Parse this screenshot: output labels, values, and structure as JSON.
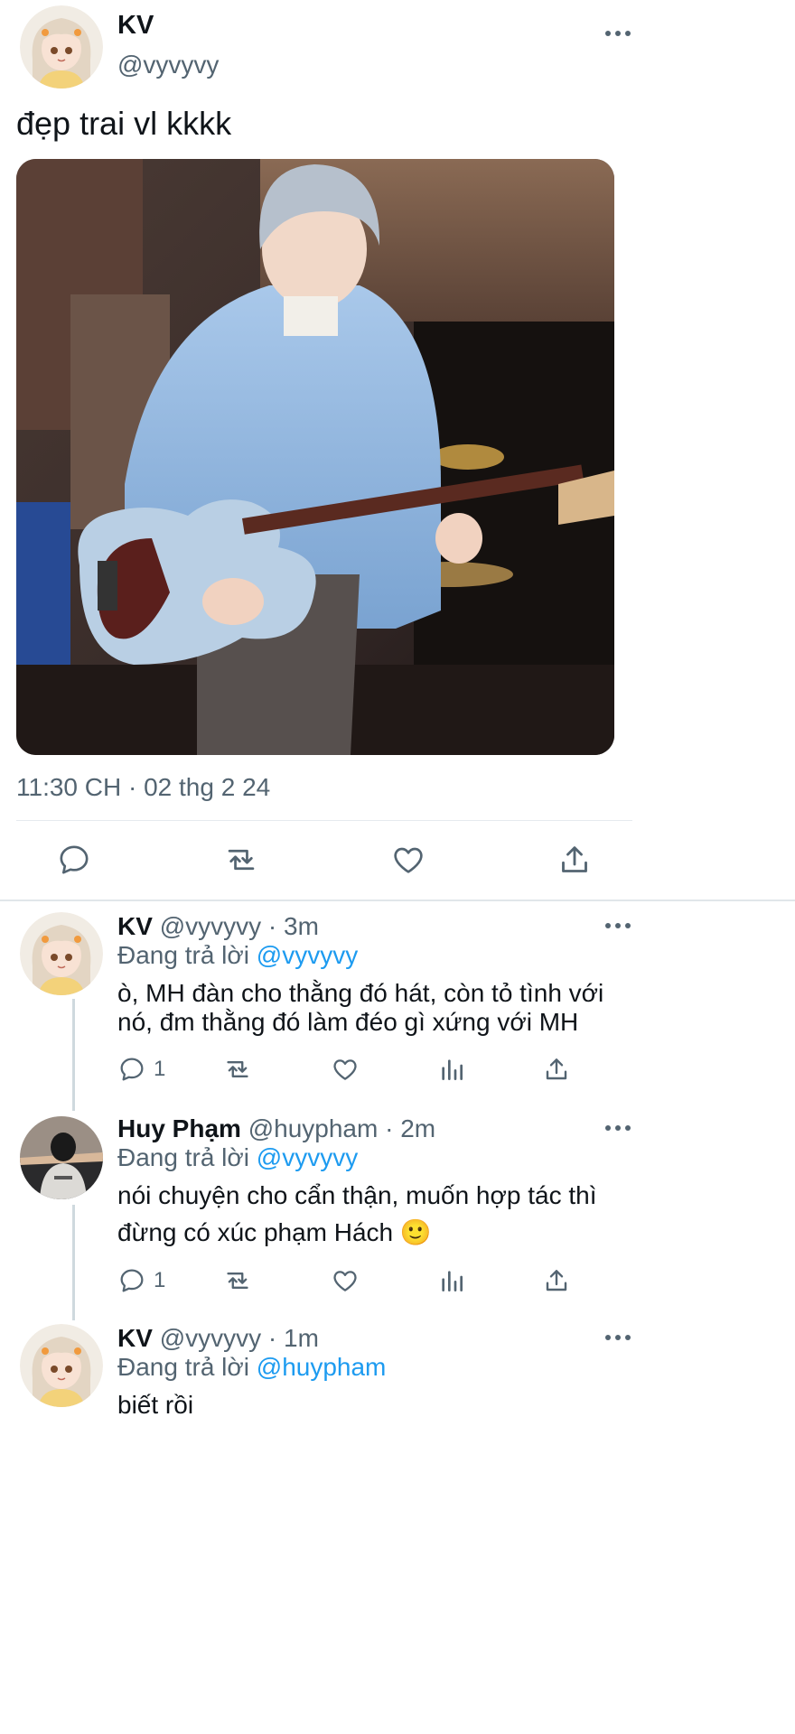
{
  "main_tweet": {
    "author_name": "KV",
    "author_handle": "@vyvyvy",
    "text": "đẹp trai vl kkkk",
    "timestamp": "11:30 CH · 02 thg 2 24",
    "image_description_icon": "photo-bassist-icon"
  },
  "replies": [
    {
      "author_name": "KV",
      "author_handle": "@vyvyvy",
      "time": "· 3m",
      "replying_prefix": "Đang trả lời",
      "replying_to": "@vyvyvy",
      "text_line1": "ò, MH đàn cho thằng đó hát, còn tỏ tình với",
      "text_line2": "nó, đm thằng đó làm đéo gì xứng với MH",
      "reply_count": "1"
    },
    {
      "author_name": "Huy Phạm",
      "author_handle": "@huypham",
      "time": "· 2m",
      "replying_prefix": "Đang trả lời",
      "replying_to": "@vyvyvy",
      "text_line1": "nói chuyện cho cẩn thận, muốn hợp tác thì",
      "text_line2": "đừng có xúc phạm Hách 🙂",
      "reply_count": "1"
    },
    {
      "author_name": "KV",
      "author_handle": "@vyvyvy",
      "time": "· 1m",
      "replying_prefix": "Đang trả lời",
      "replying_to": "@huypham",
      "text_line1": "biết rồi"
    }
  ],
  "colors": {
    "text": "#0f1419",
    "muted": "#536471",
    "link": "#1d9bf0",
    "divider": "#e6eaee"
  }
}
